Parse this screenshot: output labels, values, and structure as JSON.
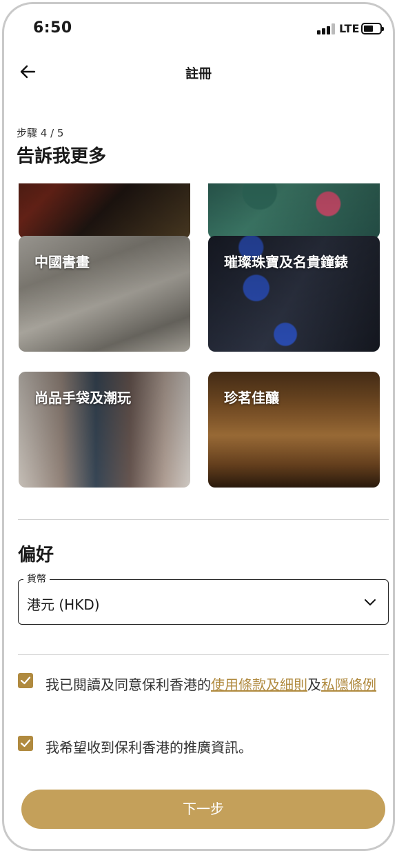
{
  "status_bar": {
    "time": "6:50",
    "network": "LTE"
  },
  "nav": {
    "title": "註冊"
  },
  "step": "步驟 4 / 5",
  "heading": "告訴我更多",
  "categories": [
    {
      "label": ""
    },
    {
      "label": ""
    },
    {
      "label": "中國書畫"
    },
    {
      "label": "璀璨珠寶及名貴鐘錶"
    },
    {
      "label": "尚品手袋及潮玩"
    },
    {
      "label": "珍茗佳釀"
    }
  ],
  "preferences": {
    "title": "偏好",
    "currency_legend": "貨幣",
    "currency_value": "港元 (HKD)"
  },
  "consent": {
    "terms_prefix": "我已閱讀及同意保利香港的",
    "terms_link": "使用條款及細則",
    "terms_middle": "及",
    "privacy_link": "私隱條例",
    "marketing": "我希望收到保利香港的推廣資訊。"
  },
  "next_button": "下一步",
  "colors": {
    "accent": "#b08a3f",
    "button": "#c4a05a"
  },
  "icons": [
    "back-arrow-icon",
    "chevron-down-icon",
    "checkmark-icon",
    "signal-icon",
    "battery-icon"
  ]
}
